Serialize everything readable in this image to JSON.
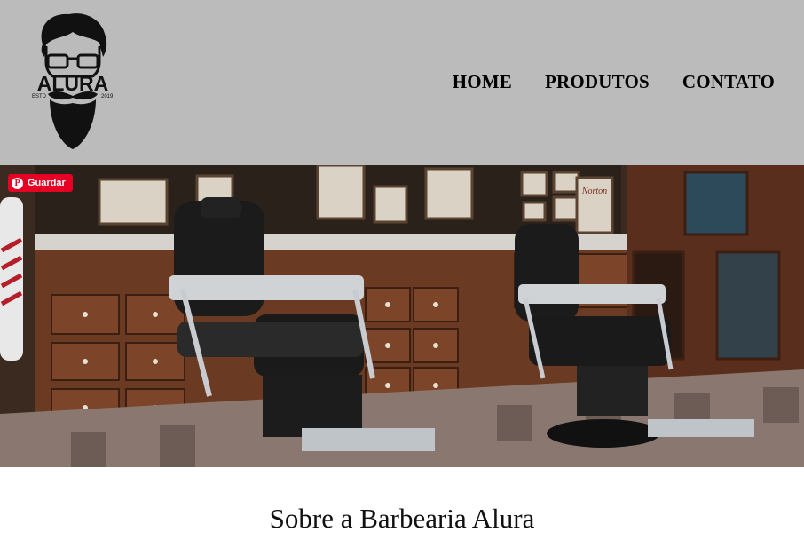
{
  "brand": {
    "name": "ALURA",
    "est_left": "ESTD",
    "est_right": "2019"
  },
  "nav": {
    "items": [
      {
        "label": "HOME"
      },
      {
        "label": "PRODUTOS"
      },
      {
        "label": "CONTATO"
      }
    ]
  },
  "banner": {
    "pin_button_label": "Guardar",
    "poster_text": "Norton"
  },
  "main": {
    "title": "Sobre a Barbearia Alura"
  },
  "colors": {
    "header_bg": "#bbbbbb",
    "pin_red": "#e60023",
    "wood": "#6b3a22"
  }
}
